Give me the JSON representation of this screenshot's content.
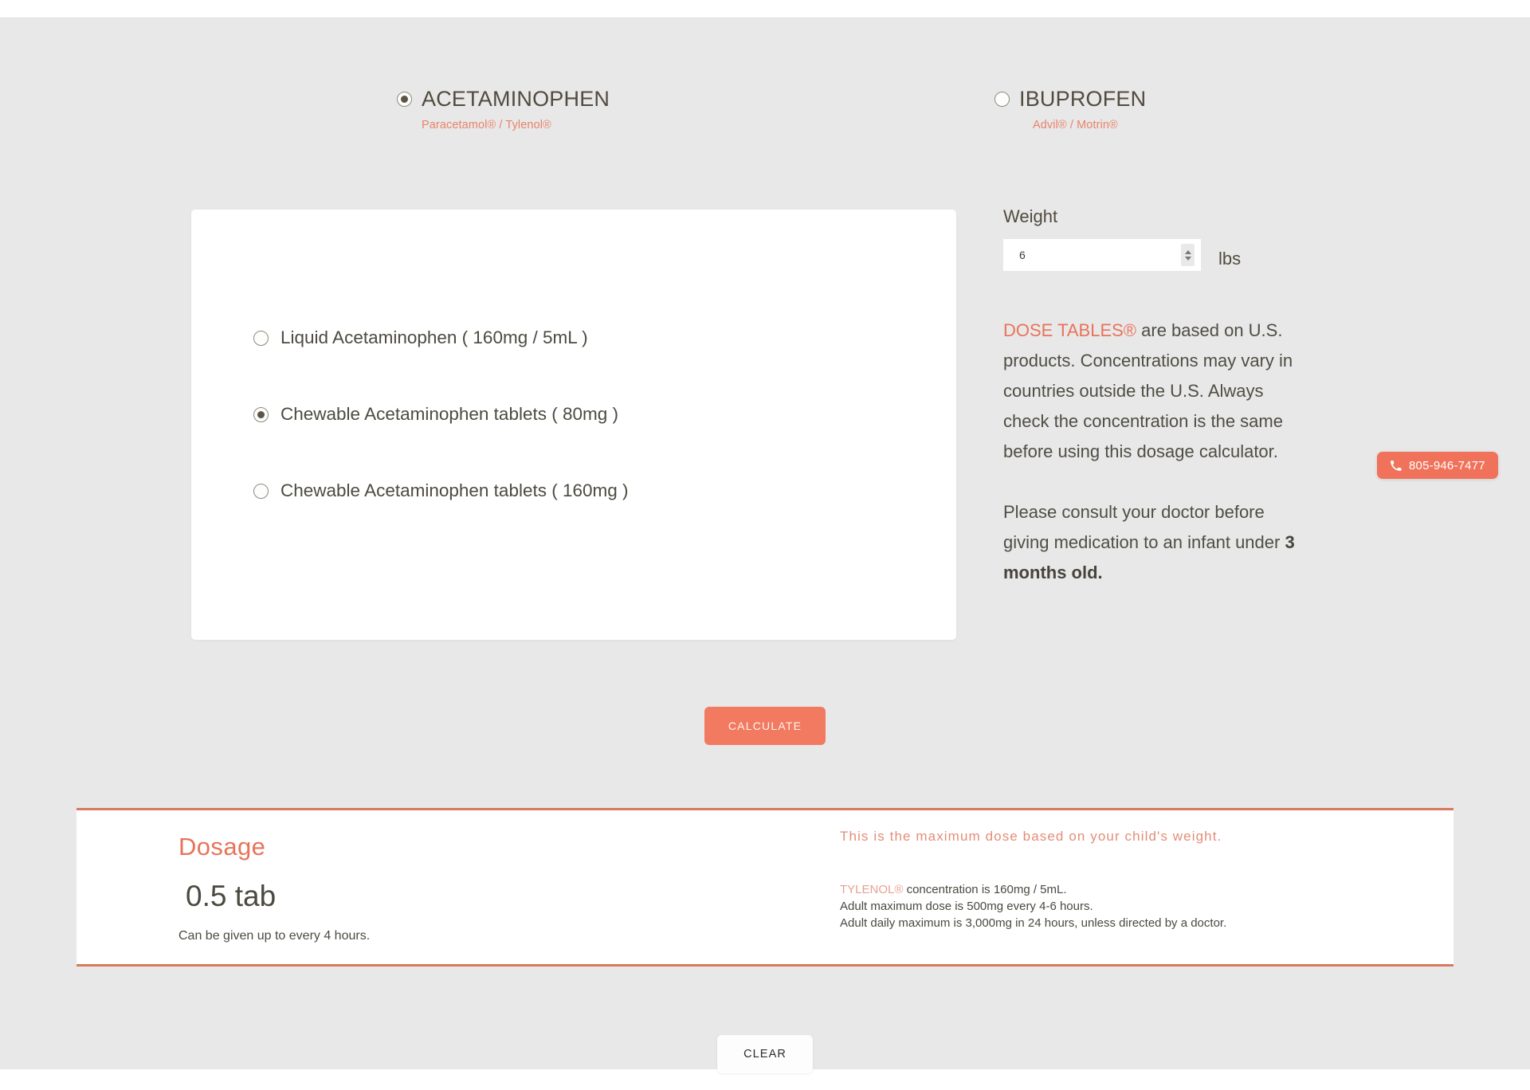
{
  "medications": [
    {
      "name": "ACETAMINOPHEN",
      "subtitle": "Paracetamol® / Tylenol®",
      "selected": true
    },
    {
      "name": "IBUPROFEN",
      "subtitle": "Advil® / Motrin®",
      "selected": false
    }
  ],
  "formulations": [
    {
      "label": "Liquid Acetaminophen ( 160mg / 5mL )",
      "selected": false
    },
    {
      "label": "Chewable Acetaminophen tablets ( 80mg )",
      "selected": true
    },
    {
      "label": "Chewable Acetaminophen tablets ( 160mg )",
      "selected": false
    }
  ],
  "weight": {
    "label": "Weight",
    "value": "6",
    "placeholder": "",
    "unit": "lbs"
  },
  "notices": {
    "dose_tables_brand": "DOSE TABLES®",
    "dose_tables_body": " are based on U.S. products. Concentrations may vary in countries outside the U.S. Always check the concentration is the same before using this dosage calculator.",
    "consult_prefix": "Please consult your doctor before giving medication to an infant under ",
    "consult_bold": "3 months old."
  },
  "phone": {
    "number": "805-946-7477",
    "icon": "phone-icon"
  },
  "actions": {
    "calculate_label": "CALCULATE",
    "clear_label": "CLEAR"
  },
  "results": {
    "title": "Dosage",
    "value": "0.5 tab",
    "note": "Can be given up to every 4 hours.",
    "headline": "This is the maximum dose based on your child's weight.",
    "fine_print": [
      {
        "brand": "TYLENOL®",
        "text": " concentration is 160mg / 5mL."
      },
      {
        "brand": "",
        "text": "Adult maximum dose is 500mg every 4-6 hours."
      },
      {
        "brand": "",
        "text": "Adult daily maximum is 3,000mg in 24 hours, unless directed by a doctor."
      }
    ]
  },
  "colors": {
    "accent": "#f0725a",
    "accent_dark": "#d8795f",
    "text": "#4c4a40",
    "background": "#e8e8e8"
  }
}
